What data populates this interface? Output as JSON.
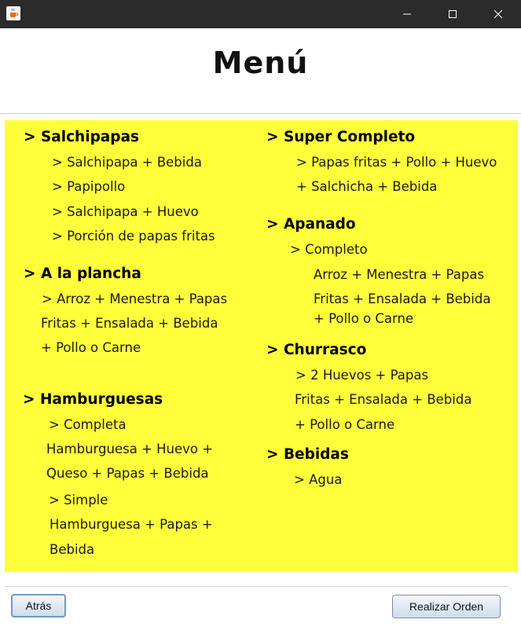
{
  "window": {
    "app_icon": "java-cup-icon"
  },
  "heading": "Menú",
  "left_column": {
    "salchipapas": {
      "title": "> Salchipapas",
      "items": [
        "> Salchipapa + Bebida",
        "> Papipollo",
        "> Salchipapa + Huevo",
        "> Porción de papas fritas"
      ]
    },
    "plancha": {
      "title": "> A la plancha",
      "lines": [
        "> Arroz + Menestra + Papas",
        "Fritas + Ensalada + Bebida",
        "+ Pollo o Carne"
      ]
    },
    "hamburguesas": {
      "title": "> Hamburguesas",
      "completa_label": "> Completa",
      "completa_lines": [
        "Hamburguesa + Huevo +",
        "Queso + Papas + Bebida"
      ],
      "simple_label": "> Simple",
      "simple_lines": [
        "Hamburguesa + Papas +",
        "Bebida"
      ]
    }
  },
  "right_column": {
    "super": {
      "title": "> Super Completo",
      "lines": [
        "> Papas fritas + Pollo + Huevo",
        "+ Salchicha + Bebida"
      ]
    },
    "apanado": {
      "title": "> Apanado",
      "sub_label": "> Completo",
      "lines": [
        "Arroz + Menestra + Papas",
        "Fritas + Ensalada + Bebida",
        "+ Pollo o Carne"
      ]
    },
    "churrasco": {
      "title": "> Churrasco",
      "lines": [
        "> 2 Huevos + Papas",
        "Fritas + Ensalada + Bebida",
        "+ Pollo o Carne"
      ]
    },
    "bebidas": {
      "title": "> Bebidas",
      "items": [
        "> Agua"
      ]
    }
  },
  "buttons": {
    "back": "Atrás",
    "order": "Realizar Orden"
  },
  "colors": {
    "panel": "#ffff3c",
    "titlebar": "#2b2b2b"
  }
}
